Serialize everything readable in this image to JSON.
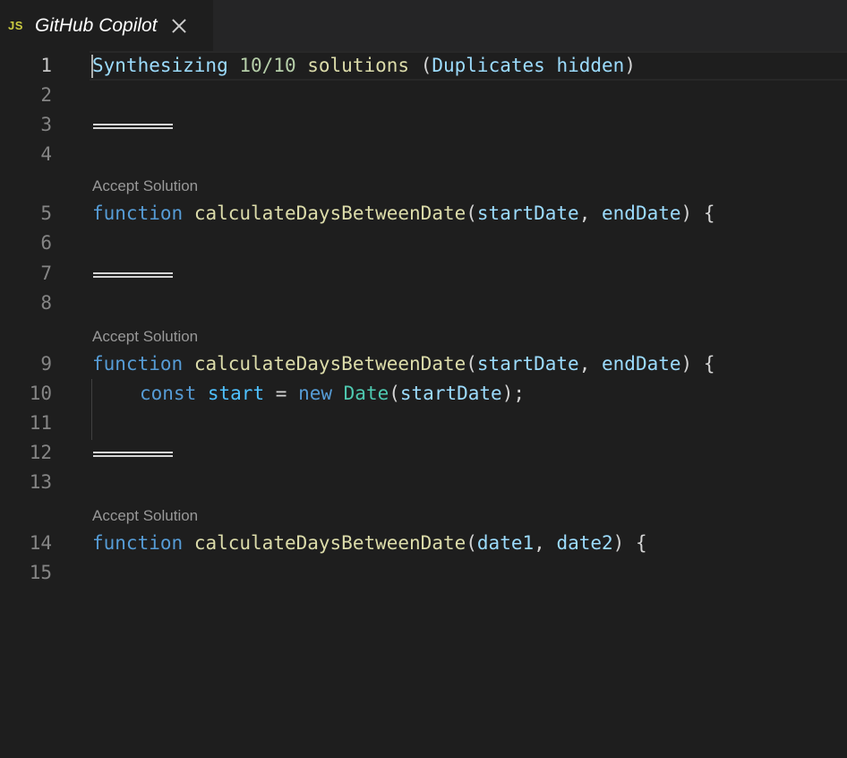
{
  "tab": {
    "language_badge": "JS",
    "title": "GitHub Copilot"
  },
  "editor": {
    "header": {
      "word1": "Synthesizing",
      "count": "10/10",
      "word2": "solutions",
      "open_paren": "(",
      "dup_word1": "Duplicates",
      "dup_word2": "hidden",
      "close_paren": ")"
    },
    "lens_label": "Accept Solution",
    "solutions": [
      {
        "keyword": "function",
        "name": "calculateDaysBetweenDate",
        "open": "(",
        "param1": "startDate",
        "comma": ",",
        "param2": "endDate",
        "close": ") {"
      },
      {
        "keyword": "function",
        "name": "calculateDaysBetweenDate",
        "open": "(",
        "param1": "startDate",
        "comma": ",",
        "param2": "endDate",
        "close": ") {",
        "body": {
          "const": "const",
          "var": "start",
          "eq": "=",
          "new": "new",
          "cls": "Date",
          "open": "(",
          "arg": "startDate",
          "close": ");"
        }
      },
      {
        "keyword": "function",
        "name": "calculateDaysBetweenDate",
        "open": "(",
        "param1": "date1",
        "comma": ",",
        "param2": "date2",
        "close": ") {"
      }
    ],
    "line_numbers": [
      "1",
      "2",
      "3",
      "4",
      "5",
      "6",
      "7",
      "8",
      "9",
      "10",
      "11",
      "12",
      "13",
      "14",
      "15"
    ]
  },
  "colors": {
    "background": "#1e1e1e",
    "keyword": "#569cd6",
    "function": "#dcdcaa",
    "variable": "#9cdcfe",
    "class": "#4ec9b0",
    "number": "#b5cea8"
  }
}
